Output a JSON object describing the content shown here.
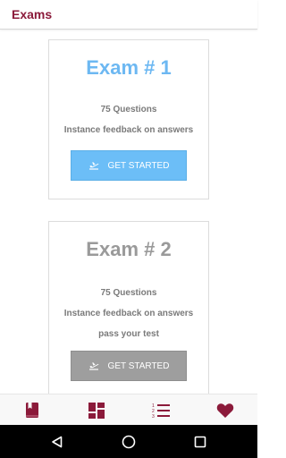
{
  "appbar": {
    "title": "Exams"
  },
  "exams": [
    {
      "title": "Exam # 1",
      "lines": [
        "75 Questions",
        "Instance feedback on answers"
      ],
      "button_label": "GET STARTED",
      "button_icon": "airplane-takeoff-icon",
      "accent": "#6cbef7"
    },
    {
      "title": "Exam # 2",
      "lines": [
        "75 Questions",
        "Instance feedback on answers",
        "pass your test"
      ],
      "button_label": "GET STARTED",
      "button_icon": "airplane-takeoff-icon",
      "accent": "#9e9e9e"
    }
  ],
  "bottom_nav": [
    {
      "icon": "book-icon"
    },
    {
      "icon": "dashboard-icon"
    },
    {
      "icon": "numbered-list-icon"
    },
    {
      "icon": "heart-icon"
    }
  ],
  "system_nav": [
    {
      "icon": "back-triangle-icon"
    },
    {
      "icon": "home-circle-icon"
    },
    {
      "icon": "recents-square-icon"
    }
  ],
  "colors": {
    "brand": "#8b1a3a",
    "exam1": "#6db8f2",
    "exam2": "#9a9a9a"
  }
}
